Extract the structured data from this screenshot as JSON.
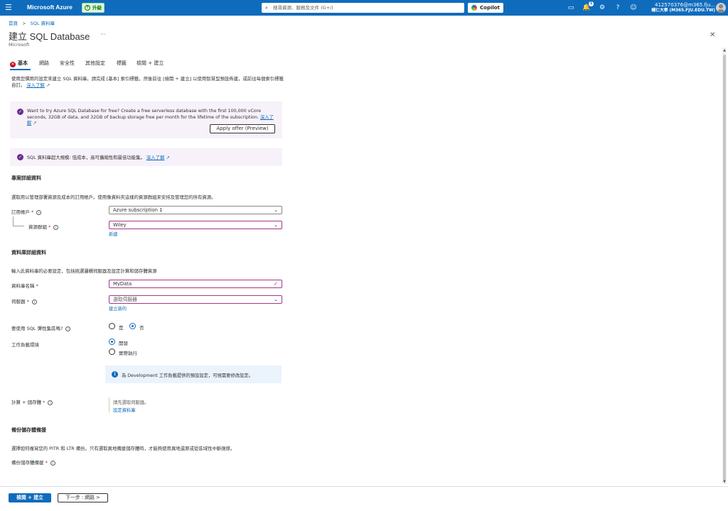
{
  "topbar": {
    "brand": "Microsoft Azure",
    "upgrade_label": "升級",
    "search_placeholder": "搜尋資源、服務及文件 (G+/)",
    "copilot_label": "Copilot",
    "notification_count": "1",
    "user_name": "412570376@m365.fju...",
    "user_org": "輔仁大學 (M365.FJU.EDU.TW)",
    "icons": [
      "menu-icon",
      "cloud-shell-icon",
      "notifications-icon",
      "settings-icon",
      "help-icon",
      "feedback-icon",
      "avatar"
    ]
  },
  "breadcrumb": {
    "home": "首頁",
    "parent": "SQL 資料庫"
  },
  "page": {
    "title": "建立 SQL Database",
    "more": "···",
    "subtitle": "Microsoft"
  },
  "tabs": [
    {
      "label": "基本",
      "active": true,
      "error": true
    },
    {
      "label": "網路"
    },
    {
      "label": "安全性"
    },
    {
      "label": "其他設定"
    },
    {
      "label": "標籤"
    },
    {
      "label": "檢閱 + 建立"
    }
  ],
  "intro": {
    "text": "使用您慣用的設定來建立 SQL 資料庫。請完成 [基本] 索引標籤，然後前往 [檢閱 + 建立] 以使用智慧型預設佈建，或前往每個索引標籤自訂。",
    "link": "深入了解"
  },
  "promo": {
    "text": "Want to try Azure SQL Database for free? Create a free serverless database with the first 100,000 vCore seconds, 32GB of data, and 32GB of backup storage free per month for the lifetime of the subscription.",
    "link": "深入了解",
    "button": "Apply offer (Preview)"
  },
  "hyperscale_info": {
    "text": "SQL 資料庫超大規模: 低成本，高可擴縮性和最佳功能集。",
    "link": "深入了解"
  },
  "project": {
    "heading": "專案詳細資料",
    "desc": "選取用以管理部署資源及成本的訂用帳戶。使用像資料夾這樣的資源群組來安排及管理您的所有資源。",
    "subscription_label": "訂用帳戶",
    "subscription_value": "Azure subscription 1",
    "rg_label": "資源群組",
    "rg_value": "Wiley",
    "rg_new": "新建"
  },
  "database": {
    "heading": "資料庫詳細資料",
    "desc": "輸入此資料庫的必要設定，包括挑選邏輯伺服器及設定計算和儲存體資源",
    "name_label": "資料庫名稱",
    "name_value": "MyData",
    "server_label": "伺服器",
    "server_placeholder": "選取伺服器",
    "server_new": "建立新的",
    "elastic_label": "要使用 SQL 彈性集區嗎?",
    "elastic_yes": "是",
    "elastic_no": "否",
    "workload_label": "工作負載環境",
    "workload_dev": "開發",
    "workload_prod": "實際執行",
    "dev_info": "為 Development 工作負載提供的預設設定，可視需要修改設定。",
    "compute_label": "計算 + 儲存體",
    "compute_text": "請先選取伺服器。",
    "compute_link": "設定資料庫"
  },
  "backup": {
    "heading": "備份儲存體備援",
    "desc": "選擇如何複寫您的 PITR 和 LTR 備份。只有選取異地備援儲存體時，才能夠使用異地還原或從區域性中斷復原。",
    "label": "備份儲存體備援"
  },
  "footer": {
    "primary": "檢閱 + 建立",
    "next": "下一步 : 網路 >"
  }
}
